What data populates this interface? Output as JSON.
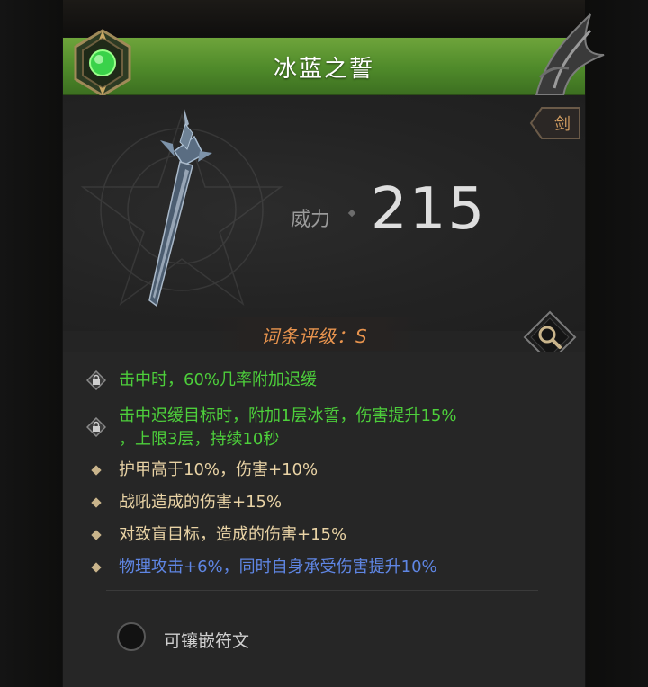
{
  "item": {
    "name": "冰蓝之誓",
    "type": "剑",
    "power_label": "威力",
    "power_value": "215",
    "grade_text": "词条评级：S"
  },
  "affixes": [
    {
      "icon": "lock-icon",
      "color": "#4dcf3b",
      "lines": [
        "击中时，60%几率附加迟缓"
      ]
    },
    {
      "icon": "lock-icon",
      "color": "#4dcf3b",
      "lines": [
        "击中迟缓目标时，附加1层冰誓，伤害提升15%",
        "，上限3层，持续10秒"
      ]
    },
    {
      "icon": "diamond-icon",
      "color": "#e9d3a5",
      "lines": [
        "护甲高于10%，伤害+10%"
      ]
    },
    {
      "icon": "diamond-icon",
      "color": "#e9d3a5",
      "lines": [
        "战吼造成的伤害+15%"
      ]
    },
    {
      "icon": "diamond-icon",
      "color": "#e9d3a5",
      "lines": [
        "对致盲目标，造成的伤害+15%"
      ]
    },
    {
      "icon": "diamond-icon",
      "color": "#5f86e4",
      "lines": [
        "物理攻击+6%，同时自身承受伤害提升10%"
      ]
    }
  ],
  "socket": {
    "label": "可镶嵌符文"
  },
  "colors": {
    "header_green": "#5a9630",
    "affix_green": "#4dcf3b",
    "affix_gold": "#e9d3a5",
    "affix_blue": "#5f86e4",
    "grade_orange": "#e9944e"
  }
}
